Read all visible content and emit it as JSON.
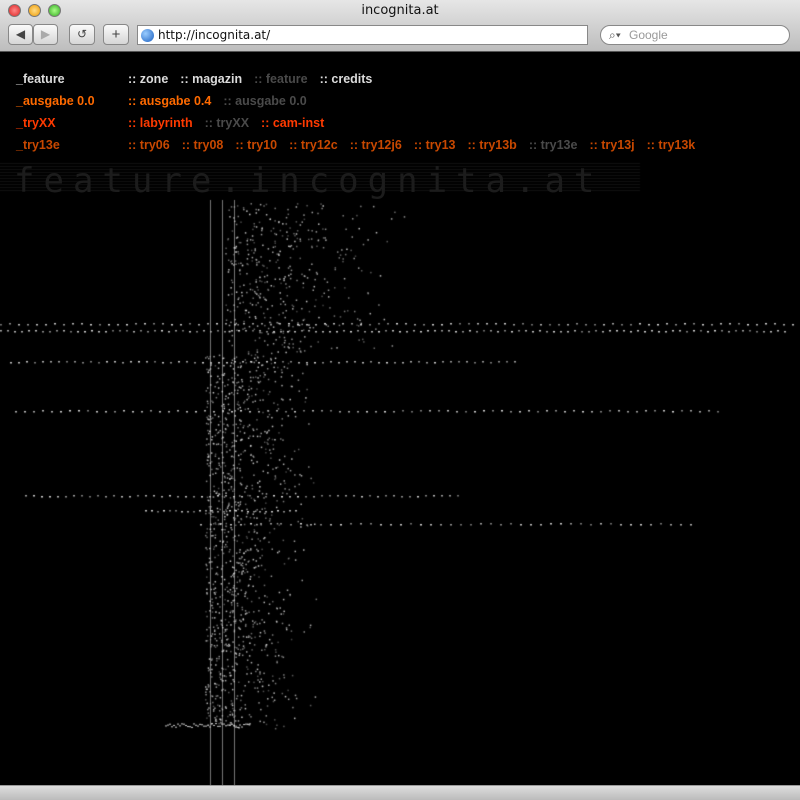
{
  "window": {
    "title": "incognita.at"
  },
  "toolbar": {
    "back": "◀",
    "forward": "▶",
    "reload": "↺",
    "add": "+",
    "url": "http://incognita.at/",
    "search_placeholder": "Google",
    "search_icon": "magnifier-icon"
  },
  "colors": {
    "white": "#dcdcdc",
    "orange": "#ff6a00",
    "red": "#ff3a00",
    "dark_orange": "#c84800",
    "inactive": "#4a4a4a"
  },
  "nav": [
    {
      "head": "_feature",
      "color": "white",
      "links": [
        {
          "label": ":: zone",
          "active": true
        },
        {
          "label": ":: magazin",
          "active": true
        },
        {
          "label": ":: feature",
          "active": false
        },
        {
          "label": ":: credits",
          "active": true
        }
      ]
    },
    {
      "head": "_ausgabe 0.0",
      "color": "orange",
      "links": [
        {
          "label": ":: ausgabe 0.4",
          "active": true
        },
        {
          "label": ":: ausgabe 0.0",
          "active": false
        }
      ]
    },
    {
      "head": "_tryXX",
      "color": "red",
      "links": [
        {
          "label": ":: labyrinth",
          "active": true
        },
        {
          "label": ":: tryXX",
          "active": false
        },
        {
          "label": ":: cam-inst",
          "active": true
        }
      ]
    },
    {
      "head": "_try13e",
      "color": "dark_orange",
      "links": [
        {
          "label": ":: try06",
          "active": true
        },
        {
          "label": ":: try08",
          "active": true
        },
        {
          "label": ":: try10",
          "active": true
        },
        {
          "label": ":: try12c",
          "active": true
        },
        {
          "label": ":: try12j6",
          "active": true
        },
        {
          "label": ":: try13",
          "active": true
        },
        {
          "label": ":: try13b",
          "active": true
        },
        {
          "label": ":: try13e",
          "active": false
        },
        {
          "label": ":: try13j",
          "active": true
        },
        {
          "label": ":: try13k",
          "active": true
        }
      ]
    }
  ],
  "watermark": "feature.incognita.at"
}
